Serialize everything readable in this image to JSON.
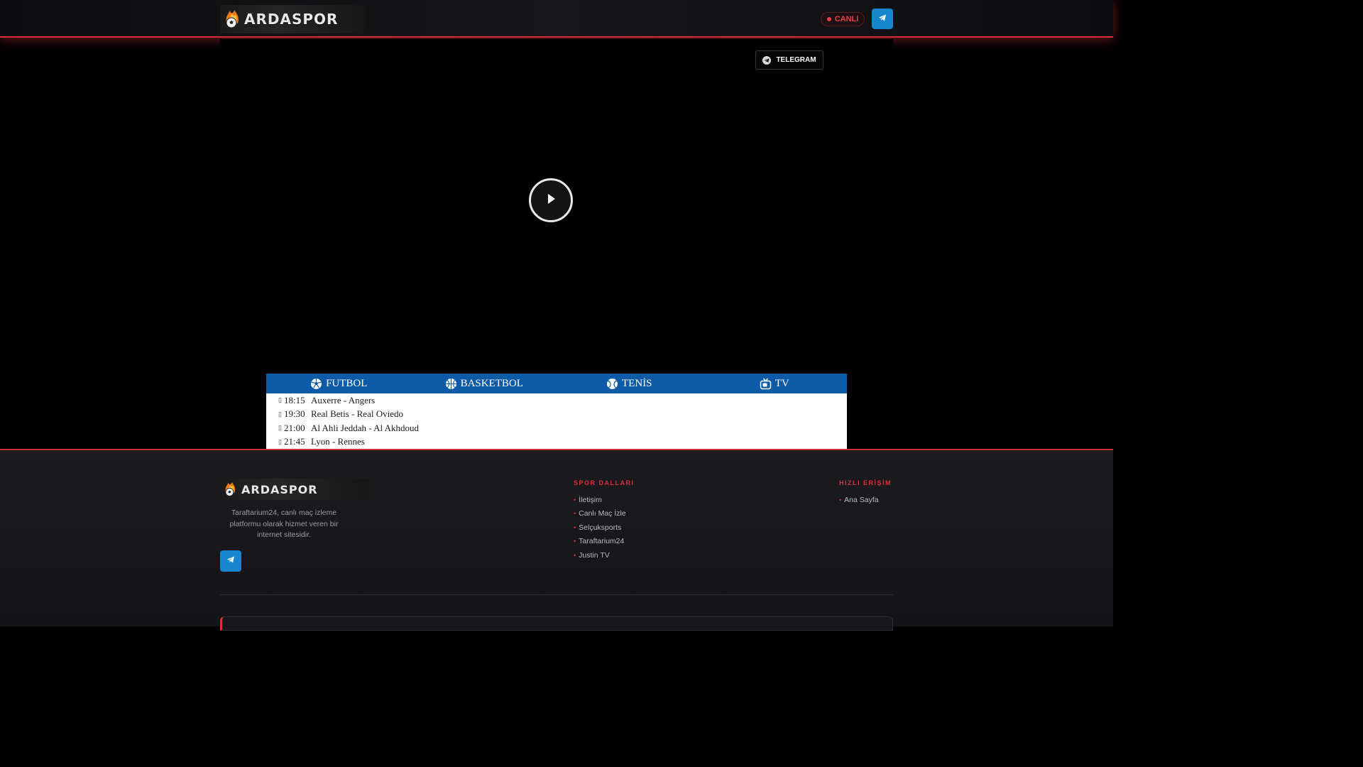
{
  "header": {
    "logo_text": "ARDASPOR",
    "live_label": "CANLI"
  },
  "player": {
    "telegram_label": "TELEGRAM"
  },
  "tabs": [
    {
      "label": "FUTBOL",
      "icon": "soccer-ball-icon"
    },
    {
      "label": "BASKETBOL",
      "icon": "basketball-icon"
    },
    {
      "label": "TENİS",
      "icon": "tennis-ball-icon"
    },
    {
      "label": "TV",
      "icon": "tv-icon"
    }
  ],
  "matches": [
    {
      "time": "18:15",
      "name": "Auxerre - Angers"
    },
    {
      "time": "19:30",
      "name": "Real Betis - Real Oviedo"
    },
    {
      "time": "21:00",
      "name": "Al Ahli Jeddah - Al Akhdoud"
    },
    {
      "time": "21:45",
      "name": "Lyon - Rennes"
    }
  ],
  "footer": {
    "logo_text": "ARDASPOR",
    "description": "Taraftarium24, canlı maç izleme platformu olarak hizmet veren bir internet sitesidir.",
    "col1_title": "SPOR DALLARI",
    "col1_items": [
      "İletişim",
      "Canlı Maç İzle",
      "Selçuksports",
      "Taraftarium24",
      "Justin TV"
    ],
    "col2_title": "HIZLI ERİŞİM",
    "col2_items": [
      "Ana Sayfa"
    ]
  },
  "colors": {
    "accent_red": "#d32f3a",
    "telegram_blue": "#1786cf",
    "tabs_blue": "#0d5aa6"
  }
}
